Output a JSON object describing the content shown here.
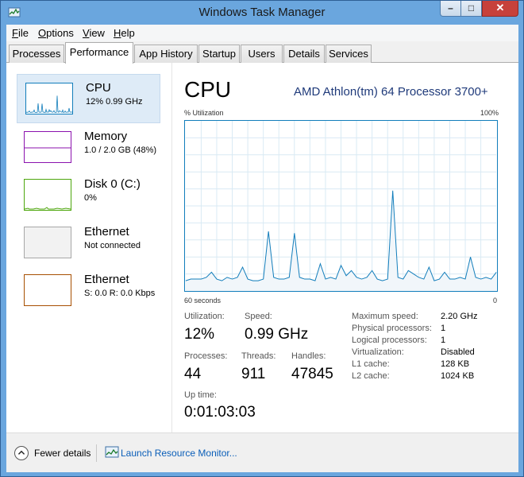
{
  "window": {
    "title": "Windows Task Manager"
  },
  "menu": [
    {
      "accel": "F",
      "rest": "ile"
    },
    {
      "accel": "O",
      "rest": "ptions"
    },
    {
      "accel": "V",
      "rest": "iew"
    },
    {
      "accel": "H",
      "rest": "elp"
    }
  ],
  "tabs": [
    "Processes",
    "Performance",
    "App History",
    "Startup",
    "Users",
    "Details",
    "Services"
  ],
  "active_tab": "Performance",
  "sidebar": [
    {
      "title": "CPU",
      "sub": "12% 0.99 GHz",
      "color": "#117dbb"
    },
    {
      "title": "Memory",
      "sub": "1.0 / 2.0 GB (48%)",
      "color": "#8b12ae"
    },
    {
      "title": "Disk 0 (C:)",
      "sub": "0%",
      "color": "#4da60c"
    },
    {
      "title": "Ethernet",
      "sub": "Not connected",
      "color": "#a7a7a7"
    },
    {
      "title": "Ethernet",
      "sub": "S: 0.0 R: 0.0 Kbps",
      "color": "#a74f01"
    }
  ],
  "panel": {
    "title": "CPU",
    "model": "AMD Athlon(tm) 64 Processor 3700+",
    "y_label": "% Utilization",
    "y_max_label": "100%",
    "x_left_label": "60 seconds",
    "x_right_label": "0"
  },
  "stats": {
    "utilization_label": "Utilization:",
    "utilization": "12%",
    "speed_label": "Speed:",
    "speed": "0.99 GHz",
    "processes_label": "Processes:",
    "processes": "44",
    "threads_label": "Threads:",
    "threads": "911",
    "handles_label": "Handles:",
    "handles": "47845",
    "uptime_label": "Up time:",
    "uptime": "0:01:03:03"
  },
  "details": [
    {
      "label": "Maximum speed:",
      "value": "2.20 GHz"
    },
    {
      "label": "Physical processors:",
      "value": "1"
    },
    {
      "label": "Logical processors:",
      "value": "1"
    },
    {
      "label": "Virtualization:",
      "value": "Disabled"
    },
    {
      "label": "L1 cache:",
      "value": "128 KB"
    },
    {
      "label": "L2 cache:",
      "value": "1024 KB"
    }
  ],
  "footer": {
    "fewer_details": "Fewer details",
    "resource_monitor": "Launch Resource Monitor..."
  },
  "chart_data": {
    "type": "area",
    "xlabel": "",
    "ylabel": "% Utilization",
    "xlim": [
      60,
      0
    ],
    "ylim": [
      0,
      100
    ],
    "grid": true,
    "series": [
      {
        "color": "#117dbb",
        "x": [
          60,
          59,
          58,
          57,
          56,
          55,
          54,
          53,
          52,
          51,
          50,
          49,
          48,
          47,
          46,
          45,
          44,
          43,
          42,
          41,
          40,
          39,
          38,
          37,
          36,
          35,
          34,
          33,
          32,
          31,
          30,
          29,
          28,
          27,
          26,
          25,
          24,
          23,
          22,
          21,
          20,
          19,
          18,
          17,
          16,
          15,
          14,
          13,
          12,
          11,
          10,
          9,
          8,
          7,
          6,
          5,
          4,
          3,
          2,
          1,
          0
        ],
        "y": [
          6,
          7,
          7,
          7,
          8,
          11,
          7,
          6,
          8,
          7,
          8,
          14,
          7,
          6,
          6,
          7,
          35,
          8,
          7,
          7,
          8,
          34,
          8,
          7,
          7,
          6,
          16,
          7,
          8,
          7,
          15,
          9,
          12,
          8,
          7,
          8,
          12,
          7,
          6,
          7,
          59,
          8,
          7,
          12,
          10,
          8,
          7,
          14,
          6,
          7,
          11,
          7,
          7,
          8,
          7,
          20,
          8,
          7,
          8,
          7,
          11
        ]
      }
    ]
  }
}
